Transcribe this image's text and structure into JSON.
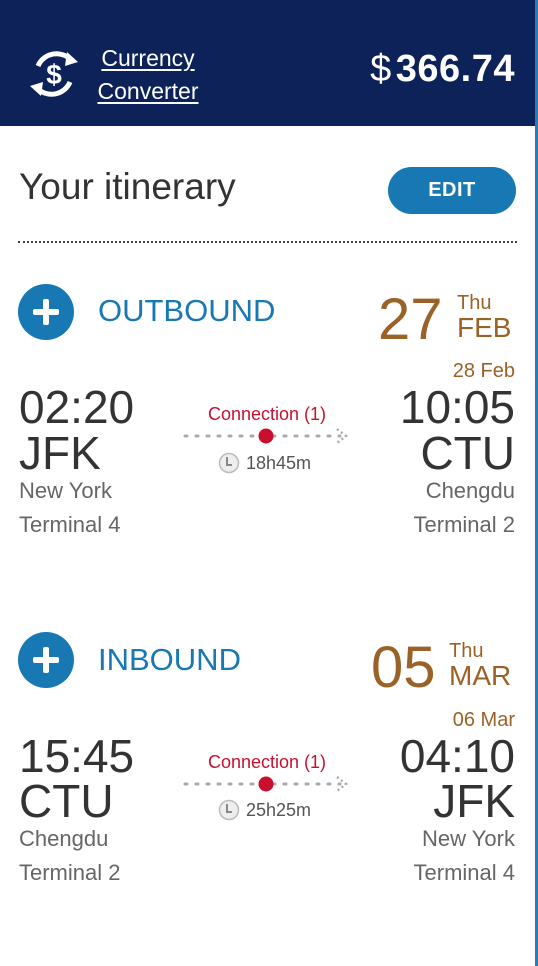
{
  "header": {
    "currency_link_line1": "Currency",
    "currency_link_line2": "Converter",
    "currency_symbol": "$",
    "price": "366.74",
    "icon": "currency-exchange-icon",
    "background_color": "#0c2258"
  },
  "itinerary": {
    "title": "Your itinerary",
    "edit_label": "EDIT"
  },
  "outbound": {
    "label": "OUTBOUND",
    "day": "27",
    "weekday": "Thu",
    "month": "FEB",
    "arrival_date": "28 Feb",
    "depart_time": "02:20",
    "depart_code": "JFK",
    "depart_city": "New York",
    "depart_terminal": "Terminal 4",
    "connection": "Connection (1)",
    "duration": "18h45m",
    "arrive_time": "10:05",
    "arrive_code": "CTU",
    "arrive_city": "Chengdu",
    "arrive_terminal": "Terminal 2"
  },
  "inbound": {
    "label": "INBOUND",
    "day": "05",
    "weekday": "Thu",
    "month": "MAR",
    "arrival_date": "06 Mar",
    "depart_time": "15:45",
    "depart_code": "CTU",
    "depart_city": "Chengdu",
    "depart_terminal": "Terminal 2",
    "connection": "Connection (1)",
    "duration": "25h25m",
    "arrive_time": "04:10",
    "arrive_code": "JFK",
    "arrive_city": "New York",
    "arrive_terminal": "Terminal 4"
  },
  "colors": {
    "accent_blue": "#1778b4",
    "date_brown": "#9b6228",
    "connection_red": "#c8102e"
  }
}
